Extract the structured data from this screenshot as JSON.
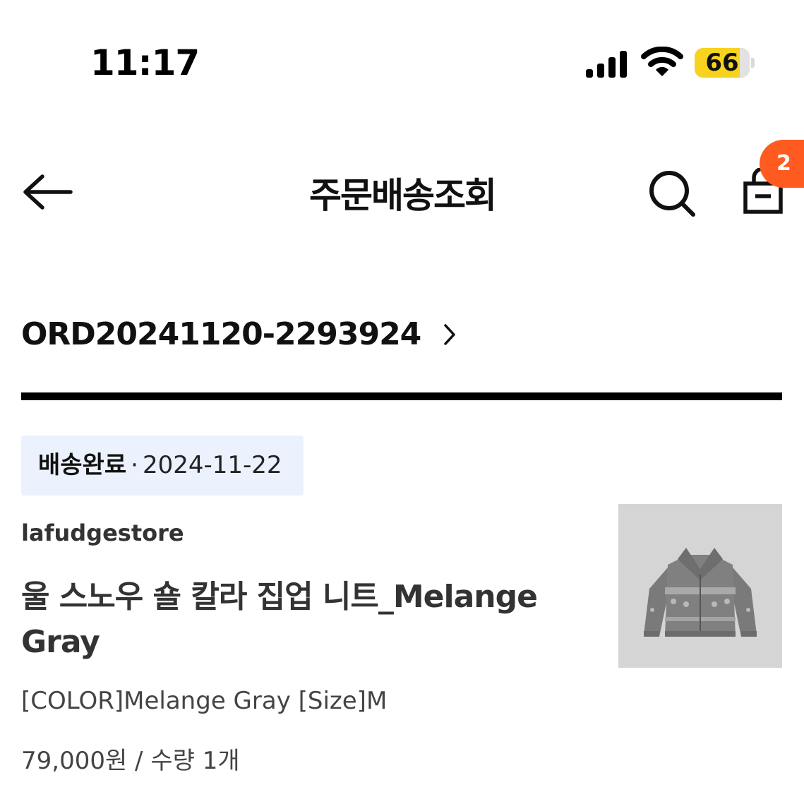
{
  "status_bar": {
    "time": "11:17",
    "battery_level": "66",
    "battery_color": "#f7d31f",
    "signal_bars": 4,
    "icons": [
      "signal-icon",
      "wifi-icon",
      "battery-icon"
    ]
  },
  "app_bar": {
    "title": "주문배송조회",
    "back_icon": "arrow-left-icon",
    "search_icon": "search-icon",
    "cart_icon": "shopping-bag-icon",
    "cart_badge_count": "2",
    "badge_color": "#ff5a1f"
  },
  "order": {
    "order_number": "ORD20241120-2293924",
    "chevron_icon": "chevron-right-icon"
  },
  "delivery": {
    "status": "배송완료",
    "separator": "·",
    "date": "2024-11-22",
    "chip_color": "#ecf2fd"
  },
  "product": {
    "store": "lafudgestore",
    "name": "울 스노우 숄 칼라 집업 니트_Melange Gray",
    "options": "[COLOR]Melange Gray [Size]M",
    "price": "79,000원",
    "quantity_separator": " / ",
    "quantity": "수량 1개",
    "thumbnail": "gray-knit-zip-up-sweater-image"
  }
}
